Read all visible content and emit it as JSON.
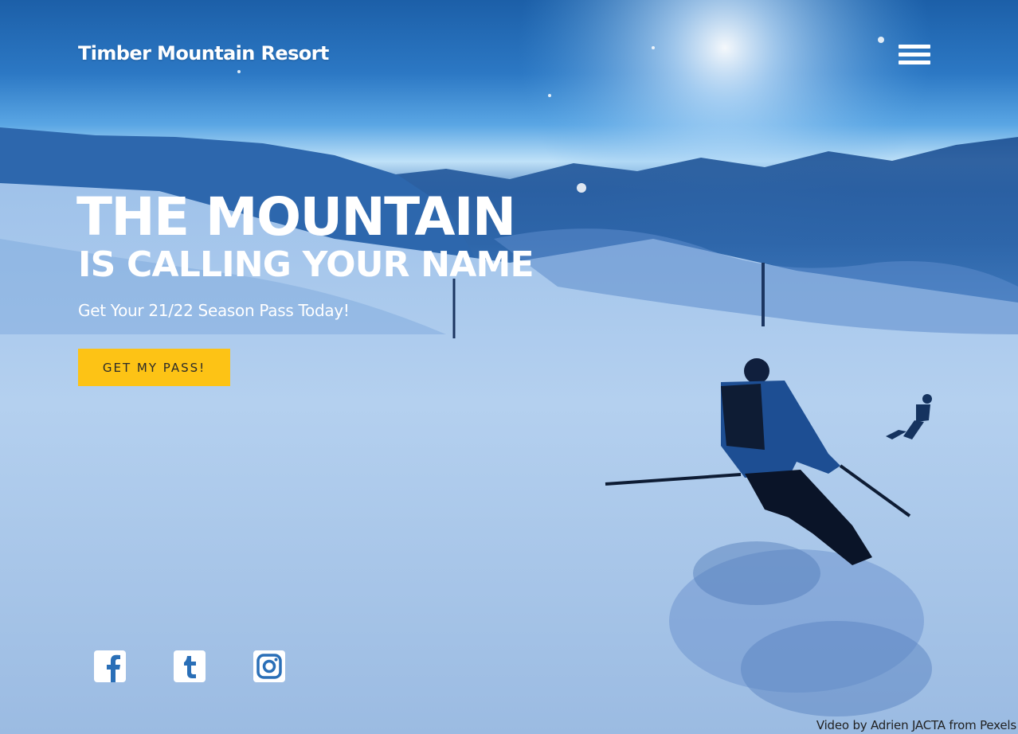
{
  "brand": {
    "name": "Timber Mountain Resort"
  },
  "nav": {
    "menu_icon": "hamburger-menu-icon"
  },
  "hero": {
    "headline_line1": "THE MOUNTAIN",
    "headline_line2": "IS CALLING YOUR NAME",
    "tagline": "Get Your 21/22 Season Pass Today!",
    "cta_label": "GET MY PASS!"
  },
  "social": [
    {
      "name": "facebook",
      "icon": "facebook-icon"
    },
    {
      "name": "tumblr",
      "icon": "tumblr-icon"
    },
    {
      "name": "instagram",
      "icon": "instagram-icon"
    }
  ],
  "credit": {
    "text": "Video by Adrien JACTA from Pexels"
  },
  "colors": {
    "accent": "#fdc315",
    "text": "#ffffff",
    "sky": "#1c5fa8",
    "snow": "#a9c8ea"
  }
}
